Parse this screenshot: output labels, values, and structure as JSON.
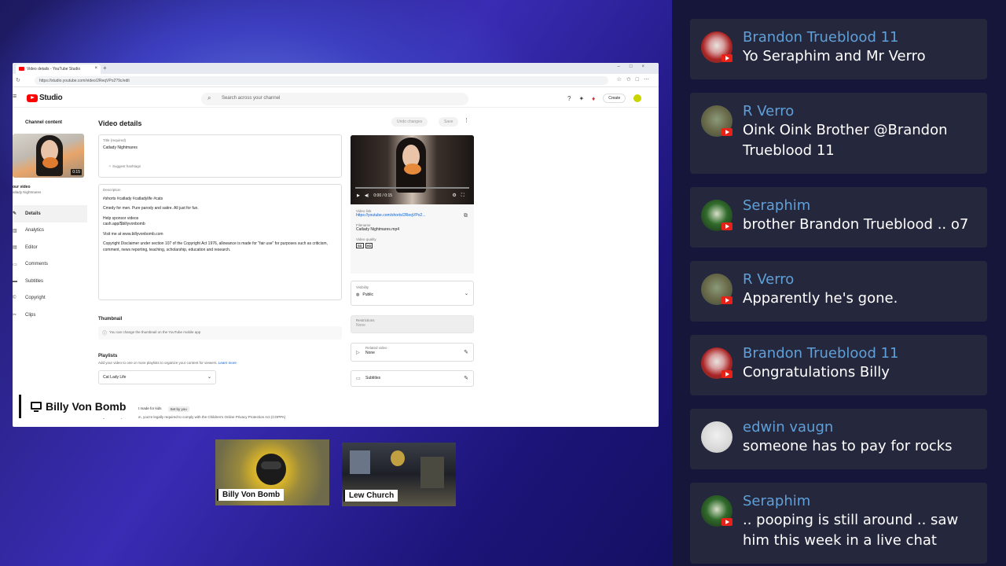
{
  "browser": {
    "tab_title": "Video details - YouTube Studio",
    "url": "https://studio.youtube.com/video/2ReqVPo2?9c/edit"
  },
  "studio": {
    "logo_text": "Studio",
    "search_placeholder": "Search across your channel",
    "create_label": "Create"
  },
  "sidebar": {
    "title": "Channel content",
    "thumb_duration": "0:15",
    "your_video_label": "our video",
    "your_video_sub": "atlady Nightmares",
    "items": [
      {
        "label": "Details",
        "icon": "pencil-icon"
      },
      {
        "label": "Analytics",
        "icon": "chart-icon"
      },
      {
        "label": "Editor",
        "icon": "film-icon"
      },
      {
        "label": "Comments",
        "icon": "comment-icon"
      },
      {
        "label": "Subtitles",
        "icon": "subtitles-icon"
      },
      {
        "label": "Copyright",
        "icon": "copyright-icon"
      },
      {
        "label": "Clips",
        "icon": "scissors-icon"
      }
    ]
  },
  "main": {
    "title": "Video details",
    "undo_label": "Undo changes",
    "save_label": "Save",
    "title_field": {
      "label": "Title (required)",
      "value": "Catlady Nightmares",
      "suggest": "Suggest hashtags"
    },
    "description": {
      "label": "Description",
      "line1": "#shorts #catlady #catladylife #cats",
      "line2": "Cmedy for men. Pure parody and satire. All just for fun.",
      "line3": "Help sponsor videos",
      "line4": "cash.app/$billyvonbomb",
      "line5": "Visit me at www.billyvonbomb.com",
      "line6": "Copyright Disclaimer under section 107 of the Copyright Act 1976, allowance is made for \"fair use\" for purposes such as criticism, comment, news reporting, teaching, scholarship, education and research."
    },
    "thumbnail_heading": "Thumbnail",
    "thumbnail_note": "You can change the thumbnail on the YouTube mobile app",
    "playlists_heading": "Playlists",
    "playlists_sub": "Add your video to one or more playlists to organize your content for viewers.",
    "learn_more": "Learn more",
    "playlist_value": "Cat Lady Life",
    "audience_text": "t made for kids",
    "audience_tag": "Set by you",
    "coppa_text": "Regardless of your location, you're legally required to comply with the Children's Online Privacy Protection Act (COPPA)"
  },
  "video_panel": {
    "time": "0:00 / 0:15",
    "link_label": "Video link",
    "link": "https://youtube.com/shorts/2ReqVPo2...",
    "filename_label": "Filename",
    "filename": "Catlady Nightmares.mp4",
    "quality_label": "Video quality",
    "quality_sd": "SD",
    "quality_hd": "HD",
    "visibility_label": "Visibility",
    "visibility_value": "Public",
    "restrictions_label": "Restrictions",
    "restrictions_value": "None",
    "related_label": "Related video",
    "related_value": "None",
    "subtitles_label": "Subtitles"
  },
  "overlay": {
    "screen_label": "Billy Von Bomb",
    "cam1_label": "Billy Von Bomb",
    "cam2_label": "Lew Church"
  },
  "chat": [
    {
      "name": "Brandon Trueblood 11",
      "text": "Yo Seraphim and Mr Verro",
      "avatar": "brandon"
    },
    {
      "name": "R Verro",
      "text": "Oink Oink Brother @Brandon Trueblood 11",
      "avatar": "rverro"
    },
    {
      "name": "Seraphim",
      "text": "brother Brandon Trueblood .. o7",
      "avatar": "seraphim"
    },
    {
      "name": "R Verro",
      "text": "Apparently he's gone.",
      "avatar": "rverro"
    },
    {
      "name": "Brandon Trueblood 11",
      "text": "Congratulations Billy",
      "avatar": "brandon"
    },
    {
      "name": "edwin vaugn",
      "text": "someone has to pay for rocks",
      "avatar": "edwin"
    },
    {
      "name": "Seraphim",
      "text": ".. pooping is still around .. saw him this week in a live chat",
      "avatar": "seraphim"
    }
  ],
  "colors": {
    "chat_name": "#5fa0d8",
    "chat_bg": "#25273d",
    "youtube_red": "#ff0000"
  }
}
